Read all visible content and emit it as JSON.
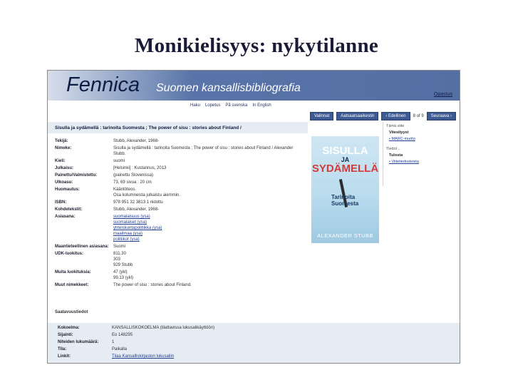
{
  "slide": {
    "title": "Monikielisyys: nykytilanne"
  },
  "banner": {
    "logo": "Fennica",
    "subtitle": "Suomen kansallisbibliografia",
    "help": "Opastus"
  },
  "nav": {
    "items": [
      "Haku",
      "Lopetus",
      "På svenska",
      "In English"
    ]
  },
  "buttons": {
    "options": "Valinnat",
    "email": "Aatsaatsaaikestin",
    "prev": "‹ Edellinen",
    "page": "8 of 9",
    "next": "Seuraava ›"
  },
  "record": {
    "title": "Sisulla ja sydämellä : tarinoita Suomesta ; The power of sisu : stories about Finland /",
    "fields": [
      {
        "label": "Tekijä:",
        "values": [
          "Stubb, Alexander, 1968-"
        ],
        "links": []
      },
      {
        "label": "Nimeke:",
        "values": [
          "Sisulla ja sydämellä : tarinoita Suomesta ; The power of sisu : stories about Finland / Alexander",
          "Stubb."
        ],
        "links": []
      },
      {
        "label": "Kieli:",
        "values": [
          "suomi"
        ],
        "links": []
      },
      {
        "label": "Julkaisu:",
        "values": [
          "[Helsinki] : Kustannus, 2013"
        ],
        "links": []
      },
      {
        "label": "Painettu/Valmistettu:",
        "values": [
          "(painettu Slovenissa)"
        ],
        "links": []
      },
      {
        "label": "Ulkoasu:",
        "values": [
          "73, 69 sivua : 20 cm"
        ],
        "links": []
      },
      {
        "label": "Huomautus:",
        "values": [
          "Kääntöteos.",
          "Osa kolumneista julkaistu aiemmin."
        ],
        "links": []
      },
      {
        "label": "ISBN:",
        "values": [
          "978 951 32 3813 1 nidottu"
        ],
        "links": []
      },
      {
        "label": "Kohdetekstit:",
        "values": [
          "Stubb, Alexander, 1968-"
        ],
        "links": []
      },
      {
        "label": "Asiasana:",
        "values": [],
        "links": [
          "suomalaisuus (ysa)",
          "suomalaiset (ysa)",
          "yhteiskuntapolitiikka (ysa)",
          "maailmaa (ysa)",
          "politiikot (ysa)"
        ]
      },
      {
        "label": "Maantieteellinen asiasana:",
        "values": [
          "Suomi"
        ],
        "links": []
      },
      {
        "label": "UDK-luokitus:",
        "values": [
          "811.30",
          "303",
          "929 Stubb"
        ],
        "links": []
      },
      {
        "label": "Muita luokituksia:",
        "values": [
          "47 (ykl)",
          "99.13 (ykl)"
        ],
        "links": []
      },
      {
        "label": "Muut nimekkeet:",
        "values": [
          "The power of sisu : stories about Finland."
        ],
        "links": []
      }
    ]
  },
  "cover": {
    "line1": "SISULLA",
    "line2": "JA",
    "line3": "SYDÄMELLÄ",
    "subtitle1": "Tarinoita",
    "subtitle2": "Suomesta",
    "author": "ALEXANDER STUBB"
  },
  "sidebar": {
    "heading1": "Tämä viite",
    "item1a": "Vitesityyst",
    "item1b": "• MARC-muoto",
    "heading2": "Tiedot ..",
    "item2a": "Tulosta",
    "item2b": "• Viitetiedostoista"
  },
  "holdings": {
    "section_label": "Saatavuustiedot",
    "rows": [
      {
        "label": "Kokoelma:",
        "value": "KANSALLISKOKOELMA (tilattavissa lukusalikäyttöön)"
      },
      {
        "label": "Sijainti:",
        "value": "Eo 148295"
      },
      {
        "label": "Niteiden lukumäärä:",
        "value": "1"
      },
      {
        "label": "Tila:",
        "value": "Paikalla"
      },
      {
        "label": "Linkit:",
        "value": "Tilaa Kansalliskirjaston lukusaliin"
      }
    ]
  }
}
